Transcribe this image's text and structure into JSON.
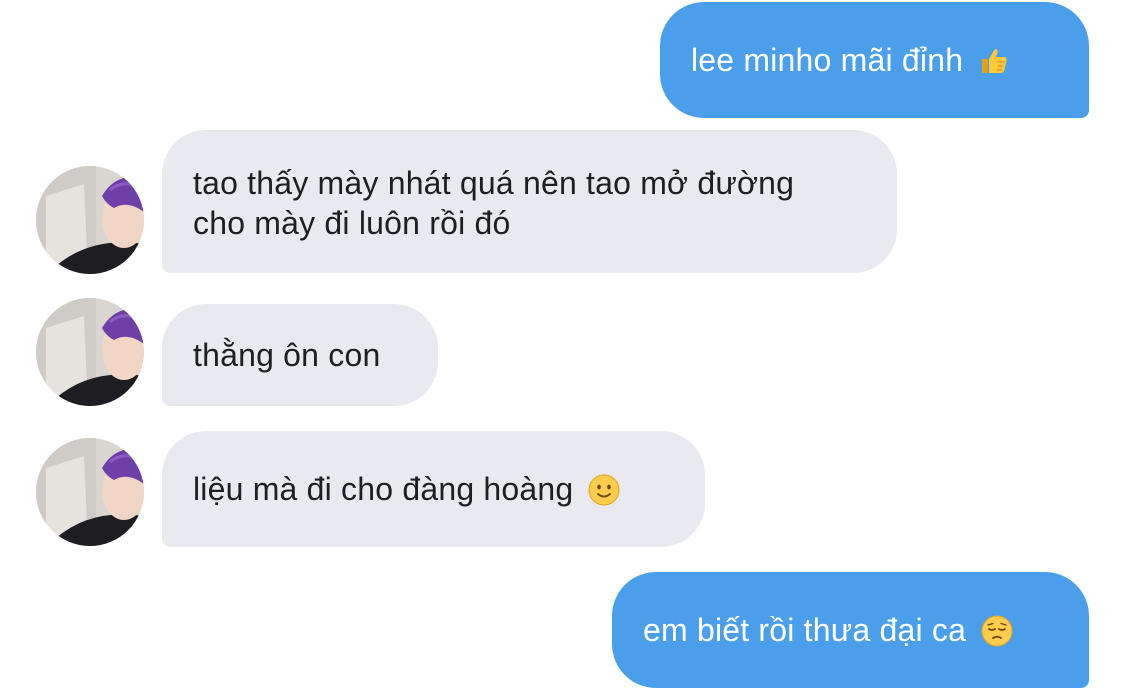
{
  "messages": [
    {
      "id": "m1",
      "sender": "self",
      "text": "lee minho mãi đỉnh",
      "emoji": "thumbs-up-icon"
    },
    {
      "id": "m2",
      "sender": "other",
      "lines": [
        "tao thấy mày nhát quá nên tao mở đường",
        "cho mày đi luôn rồi đó"
      ]
    },
    {
      "id": "m3",
      "sender": "other",
      "text": "thằng ôn con"
    },
    {
      "id": "m4",
      "sender": "other",
      "text": "liệu mà đi cho đàng hoàng",
      "emoji": "slightly-smiling-face-icon"
    },
    {
      "id": "m5",
      "sender": "self",
      "text": "em biết rồi thưa đại ca",
      "emoji": "pensive-face-icon"
    }
  ],
  "colors": {
    "sent_bubble": "#4b9fea",
    "received_bubble": "#e8eaef",
    "received_text": "#1f1f21",
    "avatar_hair": "#6f3fa8"
  }
}
